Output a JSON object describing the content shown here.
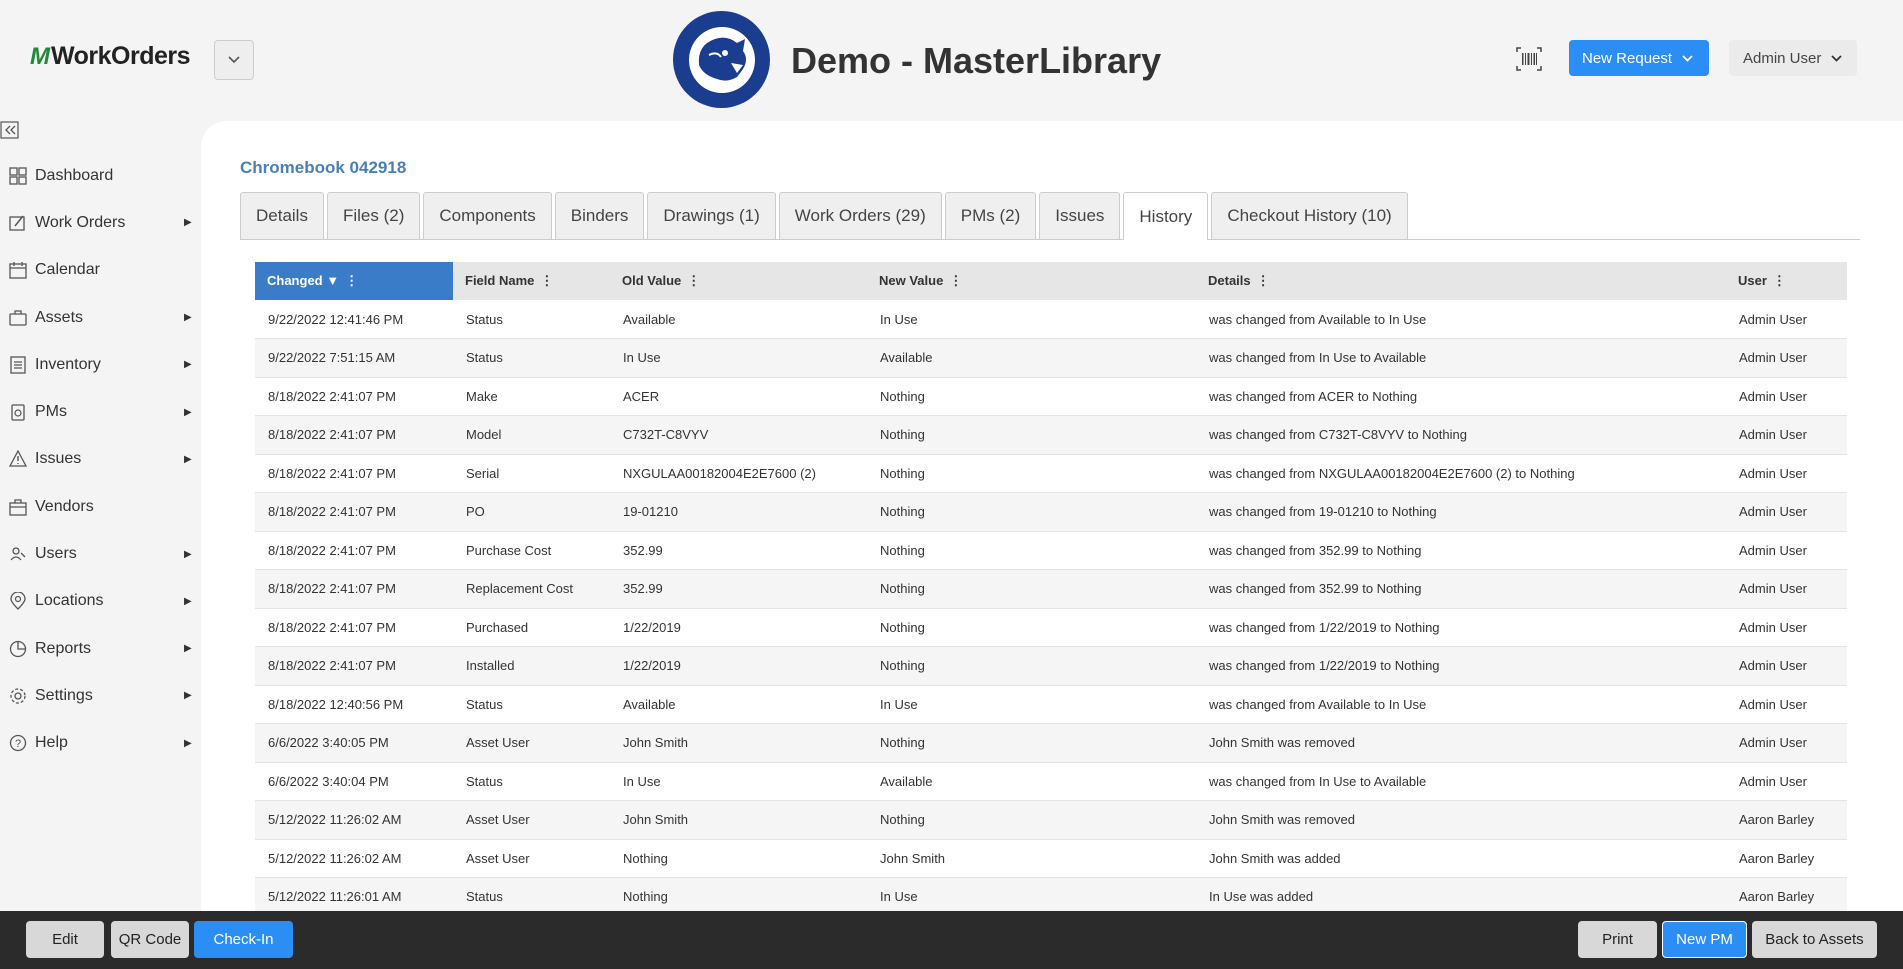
{
  "header": {
    "logo_mark": "M",
    "logo_text": "WorkOrders",
    "org_name": "Demo - MasterLibrary",
    "new_request_label": "New Request",
    "user_label": "Admin User"
  },
  "sidebar": {
    "items": [
      {
        "label": "Dashboard",
        "icon": "dashboard-icon",
        "has_submenu": false
      },
      {
        "label": "Work Orders",
        "icon": "work-orders-icon",
        "has_submenu": true
      },
      {
        "label": "Calendar",
        "icon": "calendar-icon",
        "has_submenu": false
      },
      {
        "label": "Assets",
        "icon": "assets-icon",
        "has_submenu": true
      },
      {
        "label": "Inventory",
        "icon": "inventory-icon",
        "has_submenu": true
      },
      {
        "label": "PMs",
        "icon": "pms-icon",
        "has_submenu": true
      },
      {
        "label": "Issues",
        "icon": "warning-icon",
        "has_submenu": true
      },
      {
        "label": "Vendors",
        "icon": "vendors-icon",
        "has_submenu": false
      },
      {
        "label": "Users",
        "icon": "users-icon",
        "has_submenu": true
      },
      {
        "label": "Locations",
        "icon": "location-pin-icon",
        "has_submenu": true
      },
      {
        "label": "Reports",
        "icon": "reports-icon",
        "has_submenu": true
      },
      {
        "label": "Settings",
        "icon": "gear-icon",
        "has_submenu": true
      },
      {
        "label": "Help",
        "icon": "help-icon",
        "has_submenu": true
      }
    ]
  },
  "main": {
    "asset_title": "Chromebook 042918",
    "tabs": [
      {
        "label": "Details",
        "active": false
      },
      {
        "label": "Files (2)",
        "active": false
      },
      {
        "label": "Components",
        "active": false
      },
      {
        "label": "Binders",
        "active": false
      },
      {
        "label": "Drawings (1)",
        "active": false
      },
      {
        "label": "Work Orders (29)",
        "active": false
      },
      {
        "label": "PMs (2)",
        "active": false
      },
      {
        "label": "Issues",
        "active": false
      },
      {
        "label": "History",
        "active": true
      },
      {
        "label": "Checkout History (10)",
        "active": false
      }
    ],
    "table": {
      "columns": [
        "Changed",
        "Field Name",
        "Old Value",
        "New Value",
        "Details",
        "User"
      ],
      "sorted_column": "Changed",
      "rows": [
        [
          "9/22/2022 12:41:46 PM",
          "Status",
          "Available",
          "In Use",
          "was changed from Available to In Use",
          "Admin User"
        ],
        [
          "9/22/2022 7:51:15 AM",
          "Status",
          "In Use",
          "Available",
          "was changed from In Use to Available",
          "Admin User"
        ],
        [
          "8/18/2022 2:41:07 PM",
          "Make",
          "ACER",
          "Nothing",
          "was changed from ACER to Nothing",
          "Admin User"
        ],
        [
          "8/18/2022 2:41:07 PM",
          "Model",
          "C732T-C8VYV",
          "Nothing",
          "was changed from C732T-C8VYV to Nothing",
          "Admin User"
        ],
        [
          "8/18/2022 2:41:07 PM",
          "Serial",
          "NXGULAA00182004E2E7600 (2)",
          "Nothing",
          "was changed from NXGULAA00182004E2E7600 (2) to Nothing",
          "Admin User"
        ],
        [
          "8/18/2022 2:41:07 PM",
          "PO",
          "19-01210",
          "Nothing",
          "was changed from 19-01210 to Nothing",
          "Admin User"
        ],
        [
          "8/18/2022 2:41:07 PM",
          "Purchase Cost",
          "352.99",
          "Nothing",
          "was changed from 352.99 to Nothing",
          "Admin User"
        ],
        [
          "8/18/2022 2:41:07 PM",
          "Replacement Cost",
          "352.99",
          "Nothing",
          "was changed from 352.99 to Nothing",
          "Admin User"
        ],
        [
          "8/18/2022 2:41:07 PM",
          "Purchased",
          "1/22/2019",
          "Nothing",
          "was changed from 1/22/2019 to Nothing",
          "Admin User"
        ],
        [
          "8/18/2022 2:41:07 PM",
          "Installed",
          "1/22/2019",
          "Nothing",
          "was changed from 1/22/2019 to Nothing",
          "Admin User"
        ],
        [
          "8/18/2022 12:40:56 PM",
          "Status",
          "Available",
          "In Use",
          "was changed from Available to In Use",
          "Admin User"
        ],
        [
          "6/6/2022 3:40:05 PM",
          "Asset User",
          "John Smith",
          "Nothing",
          "John Smith was removed",
          "Admin User"
        ],
        [
          "6/6/2022 3:40:04 PM",
          "Status",
          "In Use",
          "Available",
          "was changed from In Use to Available",
          "Admin User"
        ],
        [
          "5/12/2022 11:26:02 AM",
          "Asset User",
          "John Smith",
          "Nothing",
          "John Smith was removed",
          "Aaron Barley"
        ],
        [
          "5/12/2022 11:26:02 AM",
          "Asset User",
          "Nothing",
          "John Smith",
          "John Smith was added",
          "Aaron Barley"
        ],
        [
          "5/12/2022 11:26:01 AM",
          "Status",
          "Nothing",
          "In Use",
          "In Use was added",
          "Aaron Barley"
        ]
      ]
    }
  },
  "footer": {
    "edit_label": "Edit",
    "qr_label": "QR Code",
    "checkin_label": "Check-In",
    "print_label": "Print",
    "new_pm_label": "New PM",
    "back_label": "Back to Assets"
  },
  "colors": {
    "primary": "#2b8ef5",
    "sorted_header": "#3a7cc7",
    "title_link": "#4a7fb5",
    "logo_green": "#1f8a3a",
    "footer_bg": "#2b2b2b"
  }
}
